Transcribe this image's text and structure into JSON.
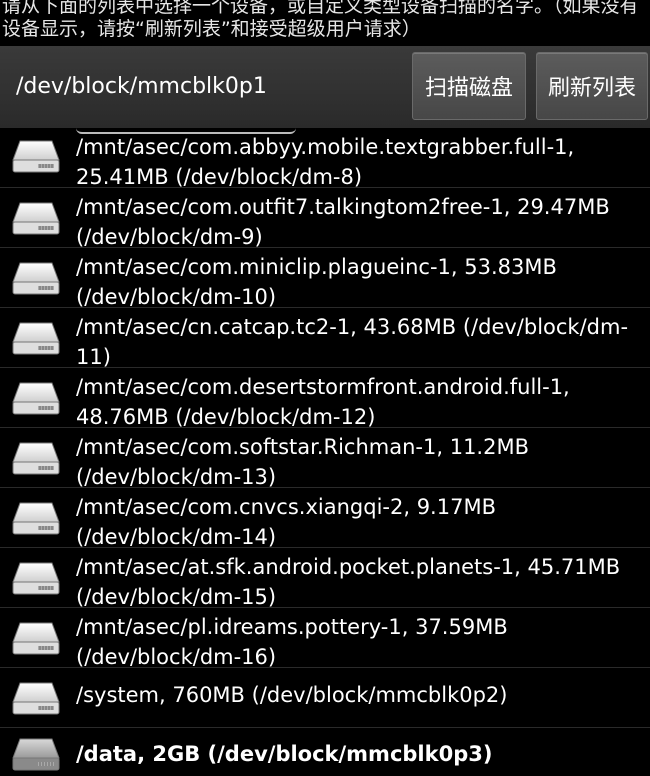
{
  "instruction": "请从下面的列表中选择一个设备，或自定义类型设备扫描的名字。（如果没有设备显示，请按“刷新列表”和接受超级用户请求）",
  "toolbar": {
    "path_value": "/dev/block/mmcblk0p1",
    "scan_label": "扫描磁盘",
    "refresh_label": "刷新列表"
  },
  "icons": {
    "disk": "hard-drive-icon"
  },
  "devices": [
    "/mnt/asec/com.abbyy.mobile.textgrabber.full-1, 25.41MB (/dev/block/dm-8)",
    "/mnt/asec/com.outfit7.talkingtom2free-1, 29.47MB (/dev/block/dm-9)",
    "/mnt/asec/com.miniclip.plagueinc-1, 53.83MB (/dev/block/dm-10)",
    "/mnt/asec/cn.catcap.tc2-1, 43.68MB (/dev/block/dm-11)",
    "/mnt/asec/com.desertstormfront.android.full-1, 48.76MB (/dev/block/dm-12)",
    "/mnt/asec/com.softstar.Richman-1, 11.2MB (/dev/block/dm-13)",
    "/mnt/asec/com.cnvcs.xiangqi-2, 9.17MB (/dev/block/dm-14)",
    "/mnt/asec/at.sfk.android.pocket.planets-1, 45.71MB (/dev/block/dm-15)",
    "/mnt/asec/pl.idreams.pottery-1, 37.59MB (/dev/block/dm-16)",
    "/system, 760MB (/dev/block/mmcblk0p2)",
    "/data, 2GB (/dev/block/mmcblk0p3)"
  ]
}
